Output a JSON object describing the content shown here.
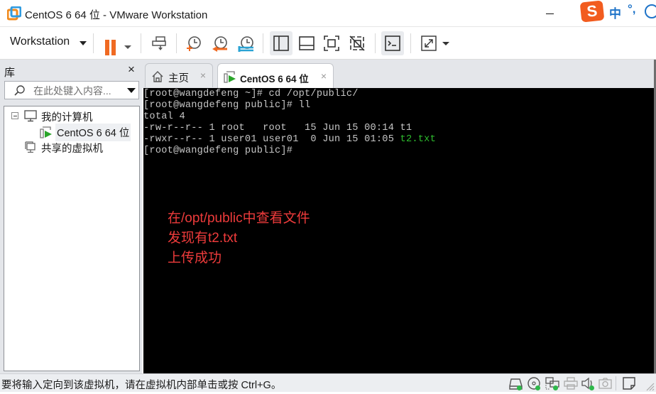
{
  "window": {
    "title": "CentOS 6 64 位 - VMware Workstation",
    "app_icon": "vmware-logo-icon"
  },
  "ime": {
    "logo": "S",
    "mode": "中",
    "punct": "°,",
    "icon": "emoji-face-icon"
  },
  "toolbar": {
    "workstation_menu": "Workstation",
    "buttons": [
      {
        "name": "pause",
        "icon": "pause-icon"
      },
      {
        "name": "send-ctrl-alt-del",
        "icon": "send-keys-icon"
      },
      {
        "name": "take-snapshot",
        "icon": "snapshot-take-icon"
      },
      {
        "name": "revert-snapshot",
        "icon": "snapshot-revert-icon"
      },
      {
        "name": "snapshot-manager",
        "icon": "snapshot-manager-icon"
      },
      {
        "name": "show-library",
        "icon": "library-panel-icon",
        "active": true
      },
      {
        "name": "show-thumbnail-bar",
        "icon": "thumbnail-bar-icon"
      },
      {
        "name": "full-screen",
        "icon": "full-screen-icon"
      },
      {
        "name": "unity",
        "icon": "unity-icon"
      },
      {
        "name": "console-view",
        "icon": "console-icon",
        "active": true
      },
      {
        "name": "stretch-guest",
        "icon": "stretch-icon"
      }
    ]
  },
  "library": {
    "title": "库",
    "close": "×",
    "search_placeholder": "在此处键入内容...",
    "tree": [
      {
        "label": "我的计算机",
        "icon": "computer-icon",
        "expanded": true,
        "level": 0
      },
      {
        "label": "CentOS 6 64 位",
        "icon": "vm-running-icon",
        "level": 1,
        "selected": true
      },
      {
        "label": "共享的虚拟机",
        "icon": "shared-vm-icon",
        "level": 0
      }
    ]
  },
  "tabs": [
    {
      "label": "主页",
      "icon": "home-icon",
      "close": "×",
      "active": false
    },
    {
      "label": "CentOS 6 64 位",
      "icon": "vm-running-icon",
      "close": "×",
      "active": true
    }
  ],
  "console": {
    "lines": [
      {
        "text": "[root@wangdefeng ~]# cd /opt/public/"
      },
      {
        "text": "[root@wangdefeng public]# ll"
      },
      {
        "text": "total 4"
      },
      {
        "text": "-rw-r--r-- 1 root   root   15 Jun 15 00:14 t1"
      },
      {
        "text": "-rwxr--r-- 1 user01 user01  0 Jun 15 01:05 ",
        "highlight": "t2.txt"
      },
      {
        "text": "[root@wangdefeng public]#"
      }
    ],
    "colors": {
      "text": "#c6c6c6",
      "highlight": "#2ebd2e",
      "background": "#000000"
    }
  },
  "annotation": {
    "lines": [
      "在/opt/public中查看文件",
      "发现有t2.txt",
      "上传成功"
    ],
    "color": "#ee3b3b"
  },
  "statusbar": {
    "message": "要将输入定向到该虚拟机，请在虚拟机内部单击或按 Ctrl+G。",
    "devices": [
      {
        "name": "hard-disk",
        "icon": "hard-disk-icon",
        "active": true
      },
      {
        "name": "cd-dvd",
        "icon": "cd-dvd-icon",
        "active": true
      },
      {
        "name": "network-adapter",
        "icon": "network-icon",
        "active": true
      },
      {
        "name": "printer",
        "icon": "printer-icon",
        "active": false
      },
      {
        "name": "sound-card",
        "icon": "sound-icon",
        "active": true
      },
      {
        "name": "camera",
        "icon": "camera-icon",
        "active": false
      }
    ],
    "message_log_icon": "message-log-icon"
  }
}
